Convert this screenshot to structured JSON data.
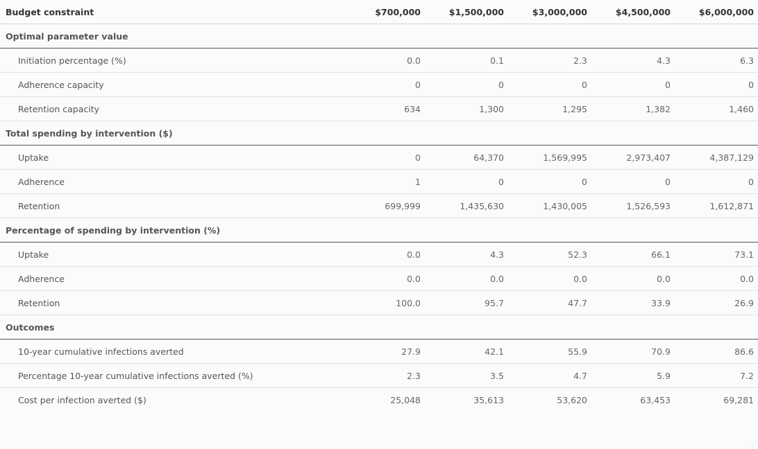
{
  "header": {
    "label": "Budget constraint",
    "columns": [
      "$700,000",
      "$1,500,000",
      "$3,000,000",
      "$4,500,000",
      "$6,000,000"
    ]
  },
  "sections": [
    {
      "title": "Optimal parameter value",
      "rows": [
        {
          "label": "Initiation percentage (%)",
          "values": [
            "0.0",
            "0.1",
            "2.3",
            "4.3",
            "6.3"
          ]
        },
        {
          "label": "Adherence capacity",
          "values": [
            "0",
            "0",
            "0",
            "0",
            "0"
          ]
        },
        {
          "label": "Retention capacity",
          "values": [
            "634",
            "1,300",
            "1,295",
            "1,382",
            "1,460"
          ]
        }
      ]
    },
    {
      "title": "Total spending by intervention ($)",
      "rows": [
        {
          "label": "Uptake",
          "values": [
            "0",
            "64,370",
            "1,569,995",
            "2,973,407",
            "4,387,129"
          ]
        },
        {
          "label": "Adherence",
          "values": [
            "1",
            "0",
            "0",
            "0",
            "0"
          ]
        },
        {
          "label": "Retention",
          "values": [
            "699,999",
            "1,435,630",
            "1,430,005",
            "1,526,593",
            "1,612,871"
          ]
        }
      ]
    },
    {
      "title": "Percentage of spending by intervention (%)",
      "rows": [
        {
          "label": "Uptake",
          "values": [
            "0.0",
            "4.3",
            "52.3",
            "66.1",
            "73.1"
          ]
        },
        {
          "label": "Adherence",
          "values": [
            "0.0",
            "0.0",
            "0.0",
            "0.0",
            "0.0"
          ]
        },
        {
          "label": "Retention",
          "values": [
            "100.0",
            "95.7",
            "47.7",
            "33.9",
            "26.9"
          ]
        }
      ]
    },
    {
      "title": "Outcomes",
      "rows": [
        {
          "label": "10-year cumulative infections averted",
          "values": [
            "27.9",
            "42.1",
            "55.9",
            "70.9",
            "86.6"
          ]
        },
        {
          "label": "Percentage 10-year cumulative infections averted (%)",
          "values": [
            "2.3",
            "3.5",
            "4.7",
            "5.9",
            "7.2"
          ]
        },
        {
          "label": "Cost per infection averted ($)",
          "values": [
            "25,048",
            "35,613",
            "53,620",
            "63,453",
            "69,281"
          ]
        }
      ]
    }
  ]
}
